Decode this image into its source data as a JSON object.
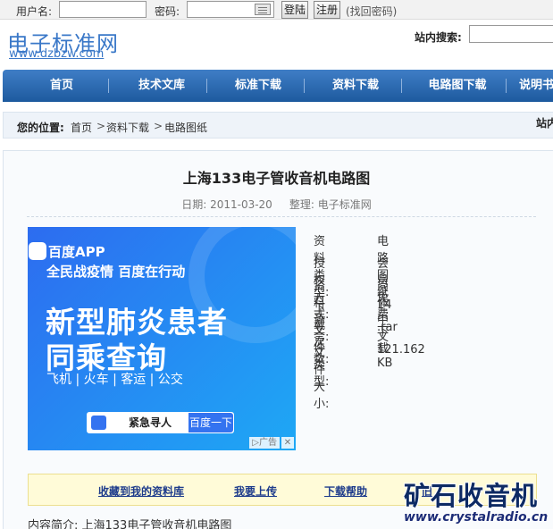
{
  "login": {
    "username_label": "用户名:",
    "username_value": "",
    "password_label": "密码:",
    "password_value": "",
    "login_button": "登陆",
    "register_button": "注册",
    "find_password": "(找回密码)"
  },
  "site": {
    "logo_cn": "电子标准网",
    "logo_en": "www.dzbzw.com",
    "search_label": "站内搜索:",
    "search_value": ""
  },
  "nav": {
    "items": [
      "首页",
      "技术文库",
      "标准下载",
      "资料下载",
      "电路图下载",
      "说明书"
    ]
  },
  "breadcrumb": {
    "lead": "您的位置:",
    "items": [
      "首页",
      "资料下载",
      "电路图纸"
    ],
    "separator": ">",
    "right_text": "站内"
  },
  "article": {
    "title": "上海133电子管收音机电路图",
    "date_label": "日期:",
    "date": "2011-03-20",
    "editor_label": "整理:",
    "editor": "电子标准网"
  },
  "ad": {
    "brand": "百度APP",
    "slogan": "全民战疫情 百度在行动",
    "headline1": "新型肺炎患者",
    "headline2": "同乘查询",
    "modes": "飞机 | 火车 | 客运 | 公交",
    "search_field": "紧急寻人",
    "search_button": "百度一下",
    "tag": "广告",
    "close": "✕"
  },
  "info": [
    {
      "key": "资料类型:",
      "value": "电路图纸"
    },
    {
      "key": "授权方式:",
      "value": "会员免费下载"
    },
    {
      "key": "资料语言:",
      "value": "简体中文"
    },
    {
      "key": "下载次数:",
      "value": "14"
    },
    {
      "key": "文件类型:",
      "value": ".rar"
    },
    {
      "key": "文件大小:",
      "value": "121.162 KB"
    }
  ],
  "actions": {
    "favorite": "收藏到我的资料库",
    "upload": "我要上传",
    "help": "下载帮助",
    "report": "旧"
  },
  "intro": "内容简介: 上海133电子管收音机电路图",
  "watermark": {
    "cn": "矿石收音机",
    "en": "www.crystalradio.cn"
  }
}
